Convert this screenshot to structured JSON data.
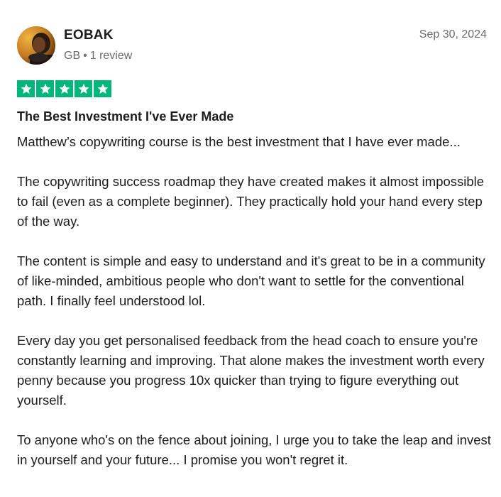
{
  "reviewer": {
    "name": "EOBAK",
    "country": "GB",
    "separator": "•",
    "review_count": "1 review"
  },
  "review": {
    "date": "Sep 30, 2024",
    "rating": 5,
    "rating_max": 5,
    "star_color": "#00b67a",
    "title": "The Best Investment I've Ever Made",
    "paragraphs": [
      "Matthew’s copywriting course is the best investment that I have ever made...",
      "The copywriting success roadmap they have created makes it almost impossible to fail (even as a complete beginner). They practically hold your hand every step of the way.",
      "The content is simple and easy to understand and it's great to be in a community of like-minded, ambitious people who don't want to settle for the conventional path. I finally feel understood lol.",
      "Every day you get personalised feedback from the head coach to ensure you're constantly learning and improving. That alone makes the investment worth every penny because you progress 10x quicker than trying to figure everything out yourself.",
      "To anyone who's on the fence about joining, I urge you to take the leap and invest in yourself and your future... I promise you won't regret it."
    ]
  },
  "icons": {
    "avatar": "avatar-photo",
    "star": "star-icon"
  }
}
